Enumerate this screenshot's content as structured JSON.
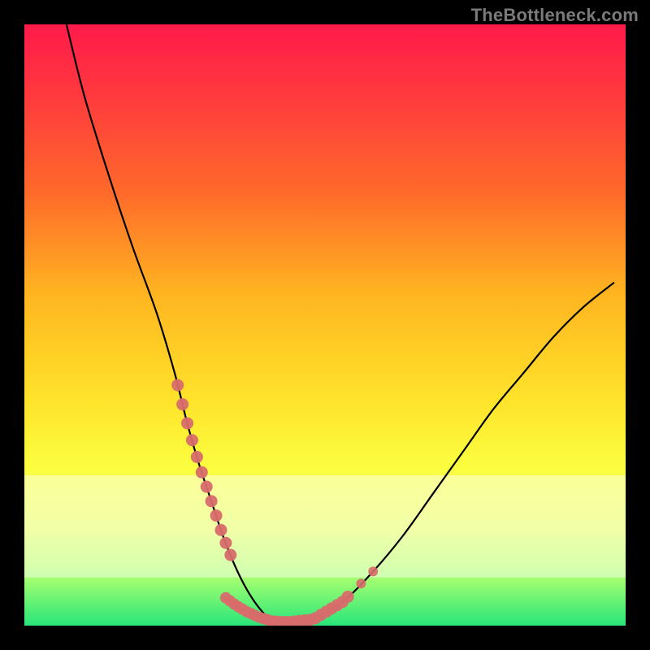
{
  "attribution": "TheBottleneck.com",
  "chart_data": {
    "type": "line",
    "title": "",
    "xlabel": "",
    "ylabel": "",
    "xlim": [
      0,
      100
    ],
    "ylim": [
      0,
      100
    ],
    "gradient_stops": [
      {
        "pct": 0,
        "color": "#ff1a4a"
      },
      {
        "pct": 12,
        "color": "#ff3a3e"
      },
      {
        "pct": 28,
        "color": "#ff6a2a"
      },
      {
        "pct": 45,
        "color": "#ffb520"
      },
      {
        "pct": 62,
        "color": "#ffe22a"
      },
      {
        "pct": 74,
        "color": "#fbff40"
      },
      {
        "pct": 84,
        "color": "#e6ff60"
      },
      {
        "pct": 92,
        "color": "#a6ff70"
      },
      {
        "pct": 100,
        "color": "#28e67a"
      }
    ],
    "pale_band": {
      "top_pct": 75,
      "bottom_pct": 92
    },
    "series": [
      {
        "name": "curve",
        "x": [
          7,
          10,
          14,
          18,
          22,
          25,
          27,
          29,
          31,
          33,
          35,
          37,
          39,
          41,
          43,
          48,
          53,
          58,
          63,
          68,
          73,
          78,
          83,
          88,
          93,
          98
        ],
        "y": [
          100,
          88,
          75,
          63,
          52,
          42,
          34,
          27,
          21,
          15,
          10,
          6,
          3,
          1,
          0.5,
          1,
          4,
          9,
          15,
          22,
          29,
          36,
          42,
          48,
          53,
          57
        ]
      }
    ],
    "marker_ranges": {
      "left_arm": {
        "x_from": 25.5,
        "x_to": 34.5
      },
      "right_arm": {
        "x_from": 43.0,
        "x_to": 54.5
      },
      "bottom": {
        "x_from": 33.5,
        "x_to": 43.5
      }
    },
    "marker_color": "#d86b6b",
    "curve_color": "#000000"
  }
}
